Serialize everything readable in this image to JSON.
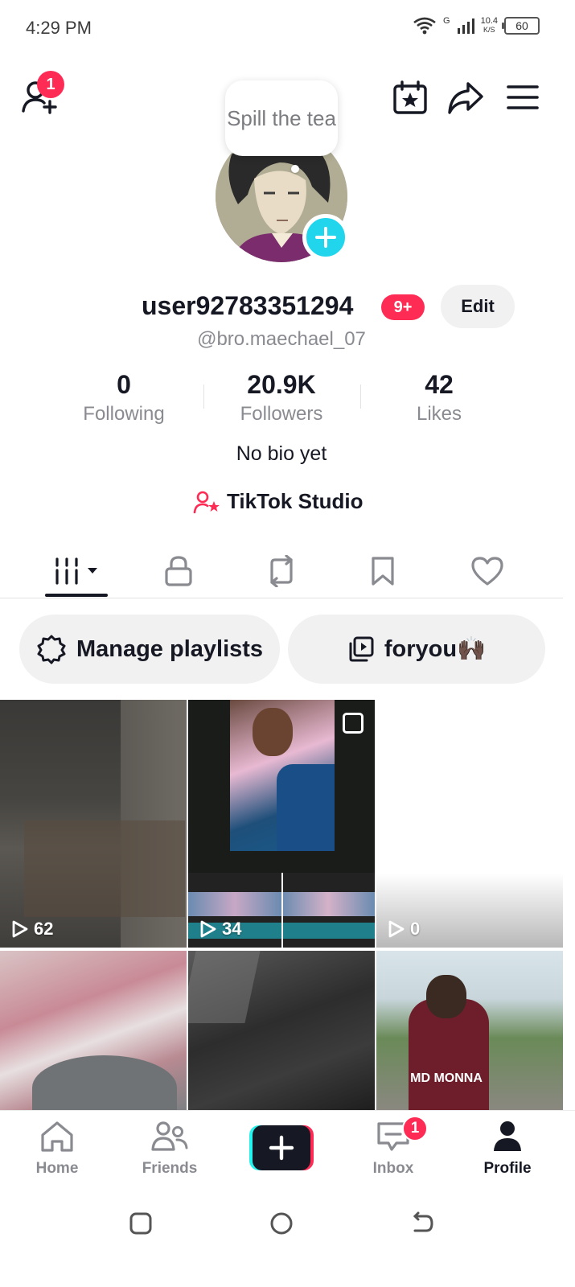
{
  "status_bar": {
    "time": "4:29 PM",
    "network": "G",
    "speed_top": "10.4",
    "speed_unit": "K/S",
    "battery": "60"
  },
  "header": {
    "add_friends_badge": "1",
    "bubble_text": "Spill the tea"
  },
  "profile": {
    "username": "user92783351294",
    "notification_count": "9+",
    "edit_label": "Edit",
    "handle": "@bro.maechael_07",
    "bio": "No bio yet",
    "studio_label": "TikTok Studio"
  },
  "stats": [
    {
      "value": "0",
      "label": "Following"
    },
    {
      "value": "20.9K",
      "label": "Followers"
    },
    {
      "value": "42",
      "label": "Likes"
    }
  ],
  "tabs": [
    {
      "icon": "videos-grid-icon"
    },
    {
      "icon": "lock-icon"
    },
    {
      "icon": "repost-icon"
    },
    {
      "icon": "bookmark-icon"
    },
    {
      "icon": "heart-icon"
    }
  ],
  "pills": {
    "manage": "Manage playlists",
    "playlist": "foryou🙌🏿"
  },
  "videos": [
    {
      "views": "62"
    },
    {
      "views": "34"
    },
    {
      "views": "0"
    },
    {
      "views": ""
    },
    {
      "views": ""
    },
    {
      "views": ""
    }
  ],
  "tile_text": {
    "jersey": "MD MONNA"
  },
  "bottom_nav": {
    "home": "Home",
    "friends": "Friends",
    "inbox": "Inbox",
    "inbox_badge": "1",
    "profile": "Profile"
  },
  "colors": {
    "accent_red": "#fe2c55",
    "accent_cyan": "#20d5ec",
    "text_primary": "#161823",
    "text_secondary": "#8a8b91"
  }
}
